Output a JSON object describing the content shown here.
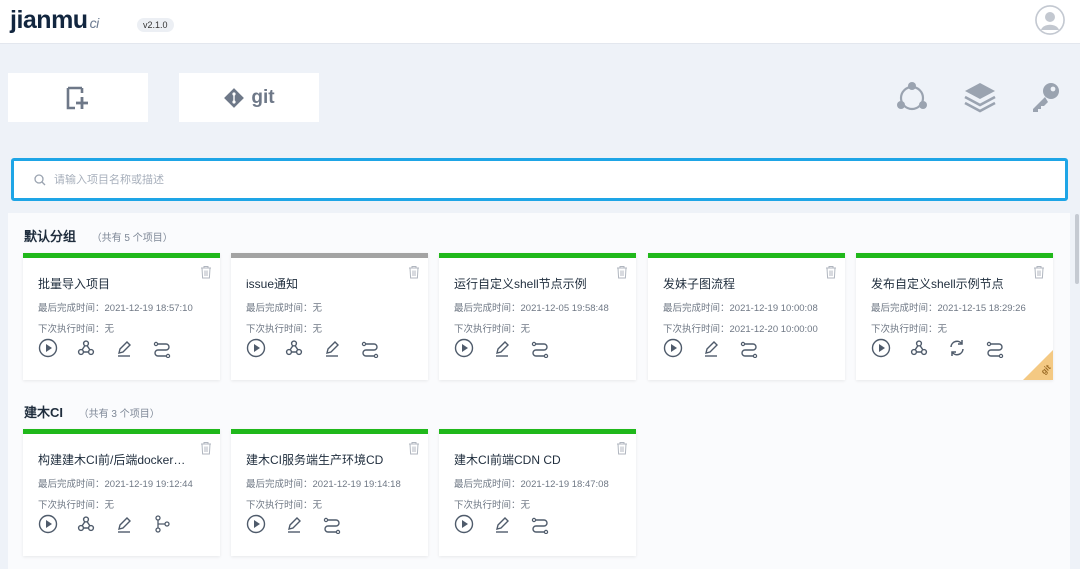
{
  "app": {
    "logo_text": "jianmu",
    "logo_ci": "ci",
    "version": "v2.1.0"
  },
  "toolbar": {
    "git_label": "git"
  },
  "search": {
    "placeholder": "请输入项目名称或描述",
    "value": ""
  },
  "labels": {
    "last_done": "最后完成时间：",
    "next_run": "下次执行时间："
  },
  "groups": [
    {
      "title": "默认分组",
      "count": "（共有 5 个项目）",
      "projects": [
        {
          "name": "批量导入项目",
          "last_done": "2021-12-19 18:57:10",
          "next_run": "无",
          "status": "success"
        },
        {
          "name": "issue通知",
          "last_done": "无",
          "next_run": "无",
          "status": "none"
        },
        {
          "name": "运行自定义shell节点示例",
          "last_done": "2021-12-05 19:58:48",
          "next_run": "无",
          "status": "success"
        },
        {
          "name": "发妹子图流程",
          "last_done": "2021-12-19 10:00:08",
          "next_run": "2021-12-20 10:00:00",
          "status": "success"
        },
        {
          "name": "发布自定义shell示例节点",
          "last_done": "2021-12-15 18:29:26",
          "next_run": "无",
          "status": "success",
          "corner": "git"
        }
      ]
    },
    {
      "title": "建木CI",
      "count": "（共有 3 个项目）",
      "projects": [
        {
          "name": "构建建木CI前/后端docker镜像",
          "last_done": "2021-12-19 19:12:44",
          "next_run": "无",
          "status": "success"
        },
        {
          "name": "建木CI服务端生产环境CD",
          "last_done": "2021-12-19 19:14:18",
          "next_run": "无",
          "status": "success"
        },
        {
          "name": "建木CI前端CDN CD",
          "last_done": "2021-12-19 18:47:08",
          "next_run": "无",
          "status": "success"
        }
      ]
    }
  ],
  "colors": {
    "success": "#20b81b",
    "none": "#a3a3a3",
    "accent": "#1ea5e6"
  }
}
